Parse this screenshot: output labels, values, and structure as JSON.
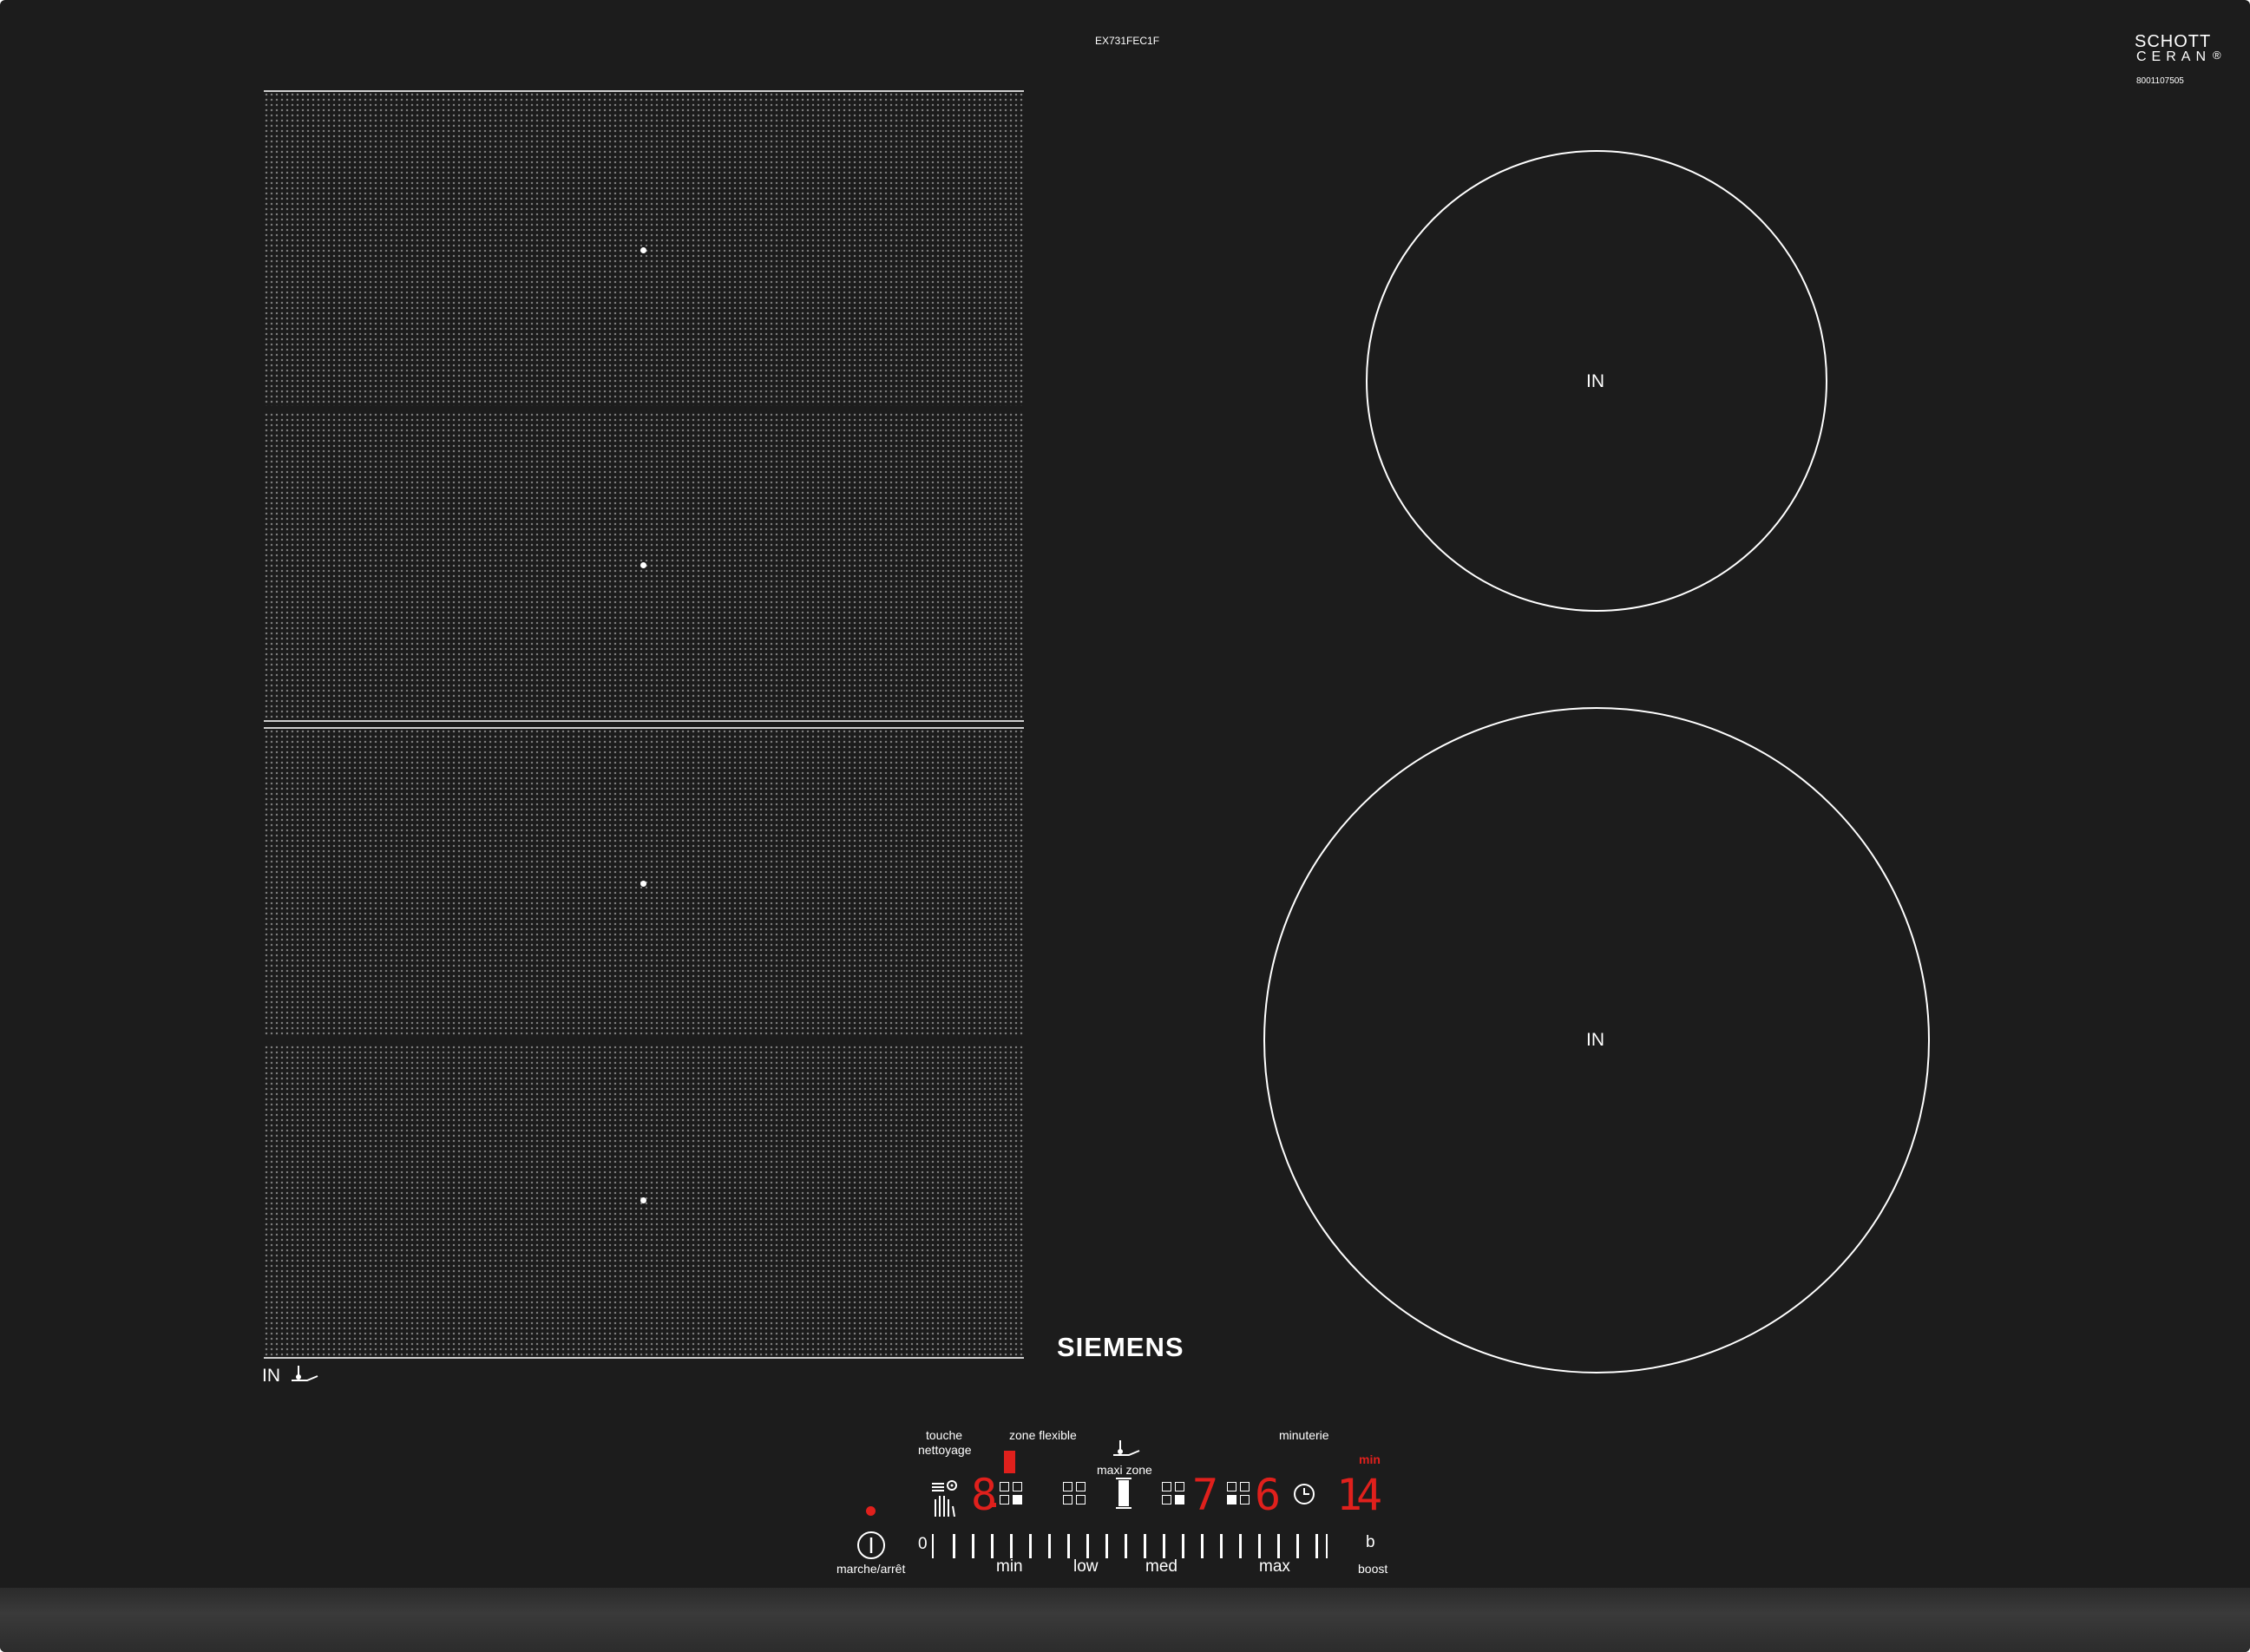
{
  "product": {
    "model_code": "EX731FEC1F",
    "glass_brand_line1": "SCHOTT",
    "glass_brand_line2": "CERAN",
    "glass_code": "8001107505",
    "brand": "SIEMENS"
  },
  "zones": {
    "round_label": "IN",
    "flex_label": "IN"
  },
  "controls": {
    "cleaning_label_1": "touche",
    "cleaning_label_2": "nettoyage",
    "flex_label": "zone flexible",
    "maxi_label": "maxi zone",
    "timer_label": "minuterie",
    "timer_unit": "min",
    "power_label": "marche/arrêt",
    "slider_zero": "0",
    "slider_min": "min",
    "slider_low": "low",
    "slider_med": "med",
    "slider_max": "max",
    "boost_key": "b",
    "boost_label": "boost",
    "display_1": "8",
    "display_2": "7",
    "display_3": "6",
    "timer_digit_1": "1",
    "timer_digit_2": "4"
  },
  "colors": {
    "glass": "#1c1c1c",
    "indicator": "#e0201c",
    "print": "#ffffff"
  }
}
